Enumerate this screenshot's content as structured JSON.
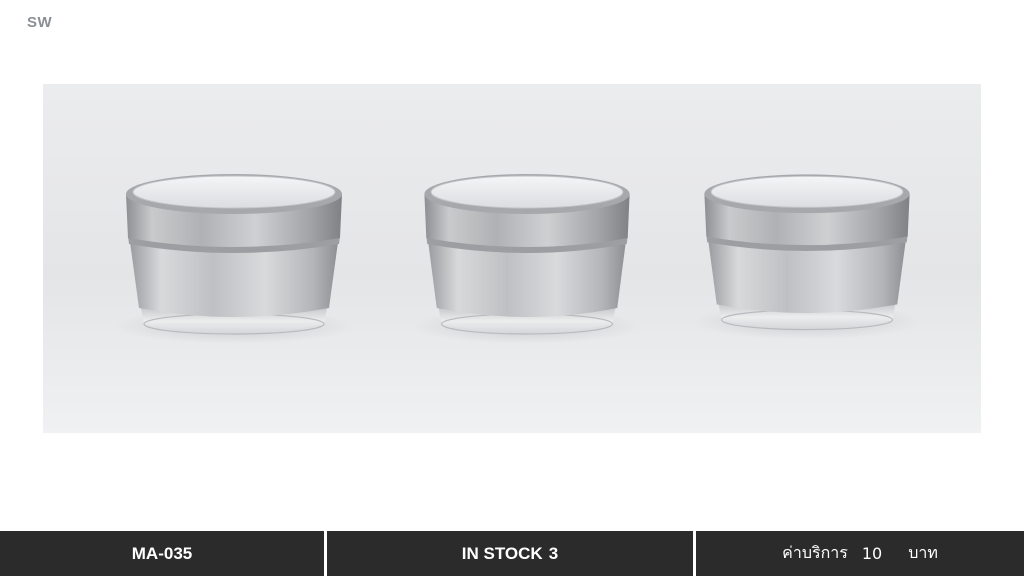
{
  "brand": "SW",
  "product_image": {
    "subject": "three-silver-acrylic-cosmetic-jars",
    "count": 3
  },
  "footer": {
    "code": "MA-035",
    "stock_label": "IN STOCK",
    "stock_value": "3",
    "service_label": "ค่าบริการ",
    "service_price": "10",
    "service_currency": "บาท"
  },
  "colors": {
    "footer_bg": "#2b2b2b",
    "footer_text": "#ffffff",
    "brand_text": "#8a8f96",
    "photo_bg": "#e6e7e9"
  }
}
